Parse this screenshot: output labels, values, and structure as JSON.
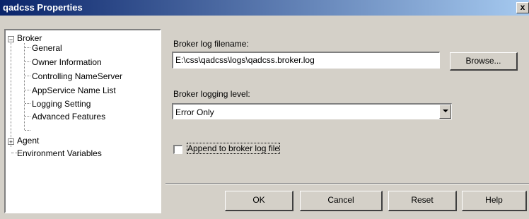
{
  "window": {
    "title": "qadcss Properties",
    "close_label": "x"
  },
  "tree": {
    "items": [
      {
        "label": "Broker",
        "expander": "−"
      },
      {
        "label": "General"
      },
      {
        "label": "Owner Information"
      },
      {
        "label": "Controlling NameServer"
      },
      {
        "label": "AppService Name List"
      },
      {
        "label": "Logging Setting"
      },
      {
        "label": "Advanced Features"
      },
      {
        "label": "Agent",
        "expander": "+"
      },
      {
        "label": "Environment Variables"
      }
    ]
  },
  "form": {
    "log_filename_label": "Broker log filename:",
    "log_filename_value": "E:\\css\\qadcss\\logs\\qadcss.broker.log",
    "browse_label": "Browse...",
    "logging_level_label": "Broker logging level:",
    "logging_level_value": "Error Only",
    "append_label": "Append to broker log file",
    "append_checked": false
  },
  "buttons": {
    "ok": "OK",
    "cancel": "Cancel",
    "reset": "Reset",
    "help": "Help"
  }
}
